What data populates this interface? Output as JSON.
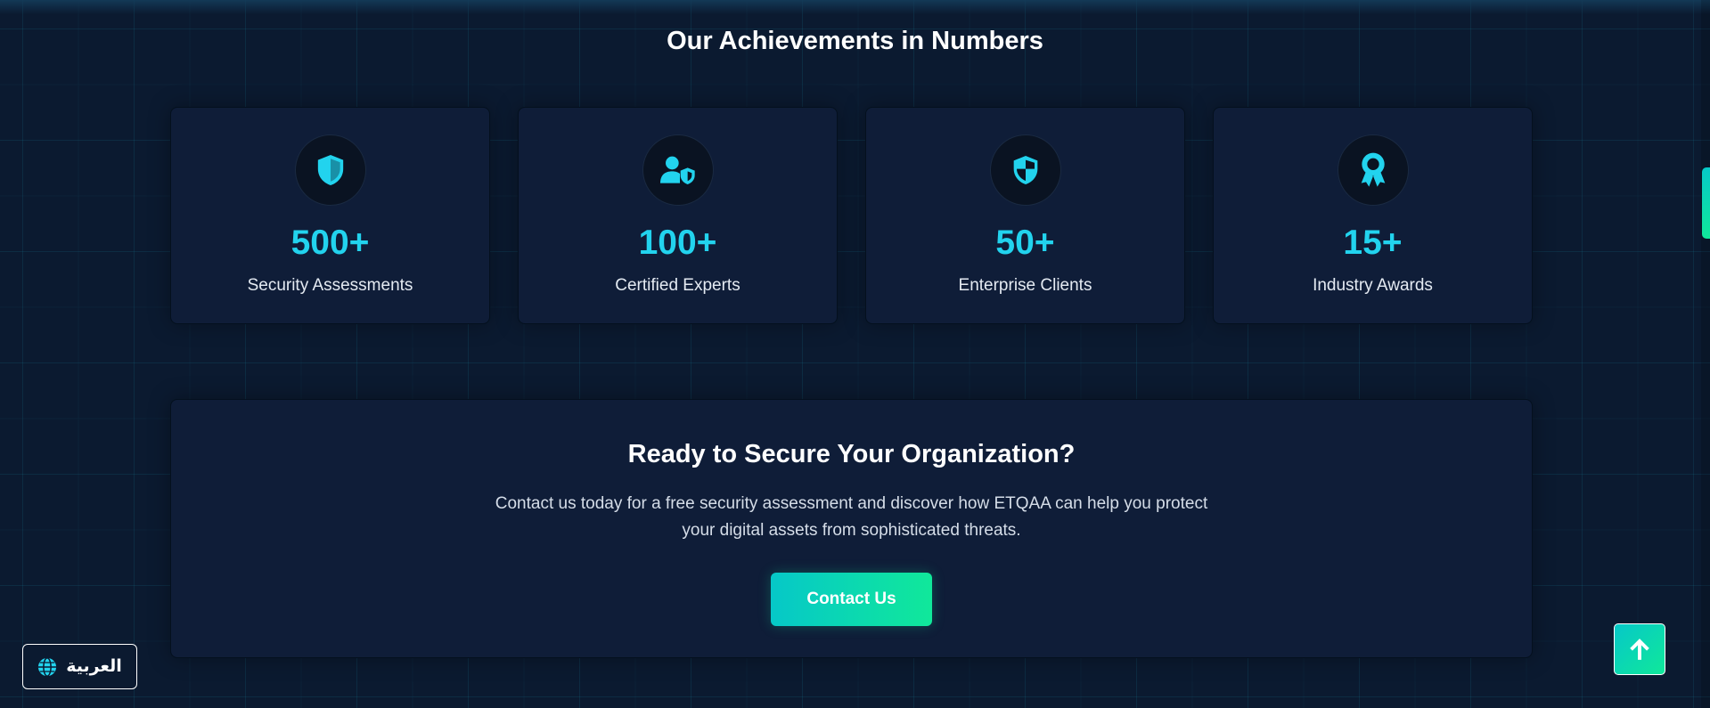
{
  "achievements": {
    "title": "Our Achievements in Numbers",
    "stats": [
      {
        "icon": "shield-icon",
        "value": "500+",
        "label": "Security Assessments"
      },
      {
        "icon": "user-shield-icon",
        "value": "100+",
        "label": "Certified Experts"
      },
      {
        "icon": "shield-halved-icon",
        "value": "50+",
        "label": "Enterprise Clients"
      },
      {
        "icon": "award-icon",
        "value": "15+",
        "label": "Industry Awards"
      }
    ]
  },
  "cta": {
    "title": "Ready to Secure Your Organization?",
    "text": "Contact us today for a free security assessment and discover how ETQAA can help you protect your digital assets from sophisticated threats.",
    "button_label": "Contact Us"
  },
  "language_switch": {
    "label": "العربية",
    "icon": "globe-icon"
  },
  "scroll_top": {
    "icon": "arrow-up-icon"
  },
  "colors": {
    "background": "#0b1a30",
    "card": "#0f1d38",
    "accent_cyan": "#22d3ee",
    "accent_green": "#10e89a"
  }
}
